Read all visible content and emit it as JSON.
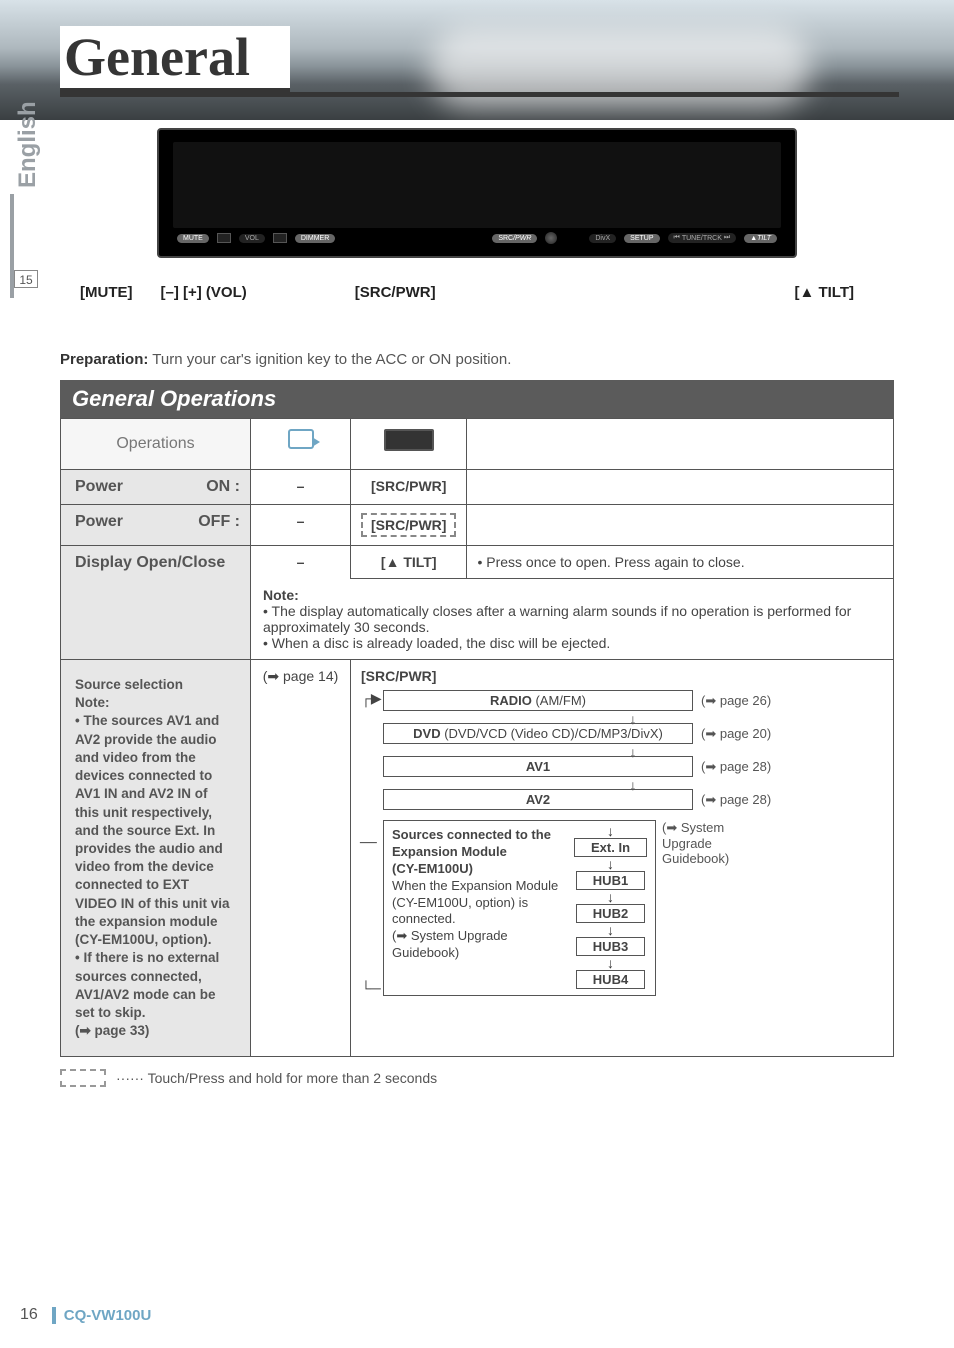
{
  "sidebar": {
    "language": "English",
    "small_page": "15"
  },
  "title": "General",
  "device": {
    "buttons": {
      "mute": "MUTE",
      "vol": "VOL",
      "dimmer": "DIMMER",
      "src": "SRC",
      "pwr": "/PWR",
      "divx": "DivX",
      "setup": "SETUP",
      "tune": "TUNE/TRCK",
      "tilt": "TILT"
    },
    "callouts": {
      "mute": "[MUTE]",
      "vol": "[–] [+] (VOL)",
      "src": "[SRC/PWR]",
      "tilt": "[▲ TILT]"
    }
  },
  "prep": {
    "label": "Preparation:",
    "text": " Turn your car's ignition key to the ACC or ON position."
  },
  "section_heading": "General Operations",
  "header_cell": "Operations",
  "rows": {
    "power_on": {
      "head": "Power",
      "sub": "ON :",
      "panel": "[SRC/PWR]"
    },
    "power_off": {
      "head": "Power",
      "sub": "OFF :",
      "panel": "[SRC/PWR]"
    },
    "open_close": {
      "head": "Display Open/Close",
      "panel": "[▲ TILT]",
      "desc": "• Press once to open. Press again to close.",
      "note_label": "Note:",
      "note1": "• The display automatically closes after a warning alarm sounds if no operation is performed for approximately 30 seconds.",
      "note2": "• When a disc is already loaded, the disc will be ejected."
    },
    "source": {
      "head": "Source selection",
      "note_label": "Note:",
      "note1": "• The sources AV1 and AV2 provide the audio and video from the devices connected to AV1 IN and AV2 IN of this unit respectively, and the source Ext. In provides the audio and video from the device connected to EXT VIDEO IN of this unit via the expansion module (CY-EM100U, option).",
      "note2": "• If there is no external sources connected, AV1/AV2 mode can be set to skip.",
      "note2_ref": "(➡ page 33)",
      "remote_ref": "(➡ page 14)",
      "panel": "[SRC/PWR]",
      "flow": {
        "radio": "RADIO",
        "radio_sub": " (AM/FM)",
        "radio_ref": "(➡ page 26)",
        "dvd": "DVD",
        "dvd_sub": " (DVD/VCD (Video CD)/CD/MP3/DivX)",
        "dvd_ref": "(➡ page 20)",
        "av1": "AV1",
        "av1_ref": "(➡ page 28)",
        "av2": "AV2",
        "av2_ref": "(➡ page 28)",
        "hub_title": "Sources connected to the Expansion Module",
        "hub_sub1": "(CY-EM100U)",
        "hub_sub2": "When the Expansion Module (CY-EM100U, option) is connected.",
        "hub_sub3": "(➡ System Upgrade Guidebook)",
        "extin": "Ext. In",
        "hub1": "HUB1",
        "hub2": "HUB2",
        "hub3": "HUB3",
        "hub4": "HUB4",
        "hub_ref": "(➡ System Upgrade Guidebook)"
      }
    }
  },
  "footer_note": " ······ Touch/Press and hold for more than 2 seconds",
  "page_number": "16",
  "model": "CQ-VW100U",
  "dash": "–"
}
